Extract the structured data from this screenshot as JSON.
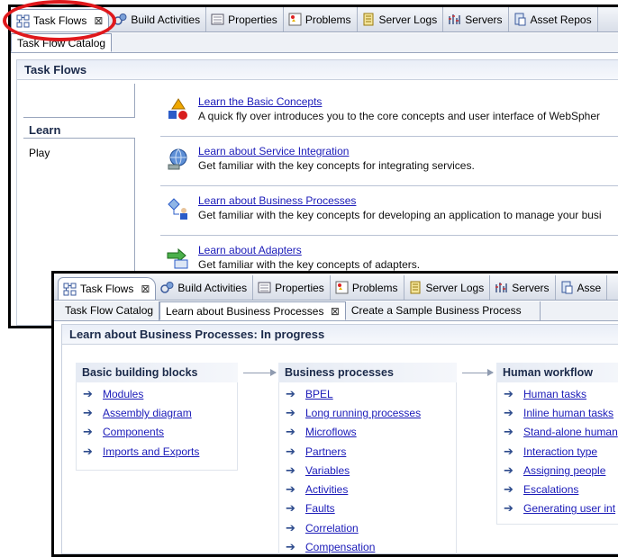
{
  "back_window": {
    "tabs": [
      {
        "label": "Task Flows",
        "icon": "task-flows-icon",
        "active": true,
        "closable": true
      },
      {
        "label": "Build Activities",
        "icon": "build-activities-icon"
      },
      {
        "label": "Properties",
        "icon": "properties-icon"
      },
      {
        "label": "Problems",
        "icon": "problems-icon"
      },
      {
        "label": "Server Logs",
        "icon": "server-logs-icon"
      },
      {
        "label": "Servers",
        "icon": "servers-icon"
      },
      {
        "label": "Asset Repos",
        "icon": "asset-repository-icon"
      }
    ],
    "subtabs": [
      {
        "label": "Task Flow Catalog",
        "active": true
      }
    ],
    "panel_title": "Task Flows",
    "left_nav": [
      {
        "label": "Learn",
        "selected": true
      },
      {
        "label": "Play",
        "selected": false
      }
    ],
    "flows": [
      {
        "icon": "basic-concepts-icon",
        "link": "Learn the Basic Concepts",
        "desc": "A quick fly over introduces you to the core concepts and user interface of WebSpher"
      },
      {
        "icon": "service-integration-icon",
        "link": "Learn about Service Integration",
        "desc": "Get familiar with the key concepts for integrating services."
      },
      {
        "icon": "business-processes-icon",
        "link": "Learn about Business Processes",
        "desc": "Get familiar with the key concepts for developing an application to manage your busi"
      },
      {
        "icon": "adapters-icon",
        "link": "Learn about Adapters",
        "desc": "Get familiar with the key concepts of adapters."
      }
    ],
    "highlight_color": "#e0181c"
  },
  "front_window": {
    "tabs": [
      {
        "label": "Task Flows",
        "icon": "task-flows-icon",
        "active": true,
        "closable": true
      },
      {
        "label": "Build Activities",
        "icon": "build-activities-icon"
      },
      {
        "label": "Properties",
        "icon": "properties-icon"
      },
      {
        "label": "Problems",
        "icon": "problems-icon"
      },
      {
        "label": "Server Logs",
        "icon": "server-logs-icon"
      },
      {
        "label": "Servers",
        "icon": "servers-icon"
      },
      {
        "label": "Asse",
        "icon": "asset-repository-icon"
      }
    ],
    "subtabs": [
      {
        "label": "Task Flow Catalog",
        "active": false
      },
      {
        "label": "Learn about Business Processes",
        "active": true,
        "closable": true
      },
      {
        "label": "Create a Sample Business Process",
        "active": false
      }
    ],
    "panel_title": "Learn about Business Processes: In progress",
    "columns": [
      {
        "title": "Basic building blocks",
        "items": [
          "Modules",
          "Assembly diagram",
          "Components",
          "Imports and Exports"
        ]
      },
      {
        "title": "Business processes",
        "items": [
          "BPEL",
          "Long running processes",
          "Microflows",
          "Partners",
          "Variables",
          "Activities",
          "Faults",
          "Correlation",
          "Compensation"
        ]
      },
      {
        "title": "Human workflow",
        "items": [
          "Human tasks",
          "Inline human tasks",
          "Stand-alone human",
          "Interaction type",
          "Assigning people",
          "Escalations",
          "Generating user int"
        ]
      }
    ]
  }
}
